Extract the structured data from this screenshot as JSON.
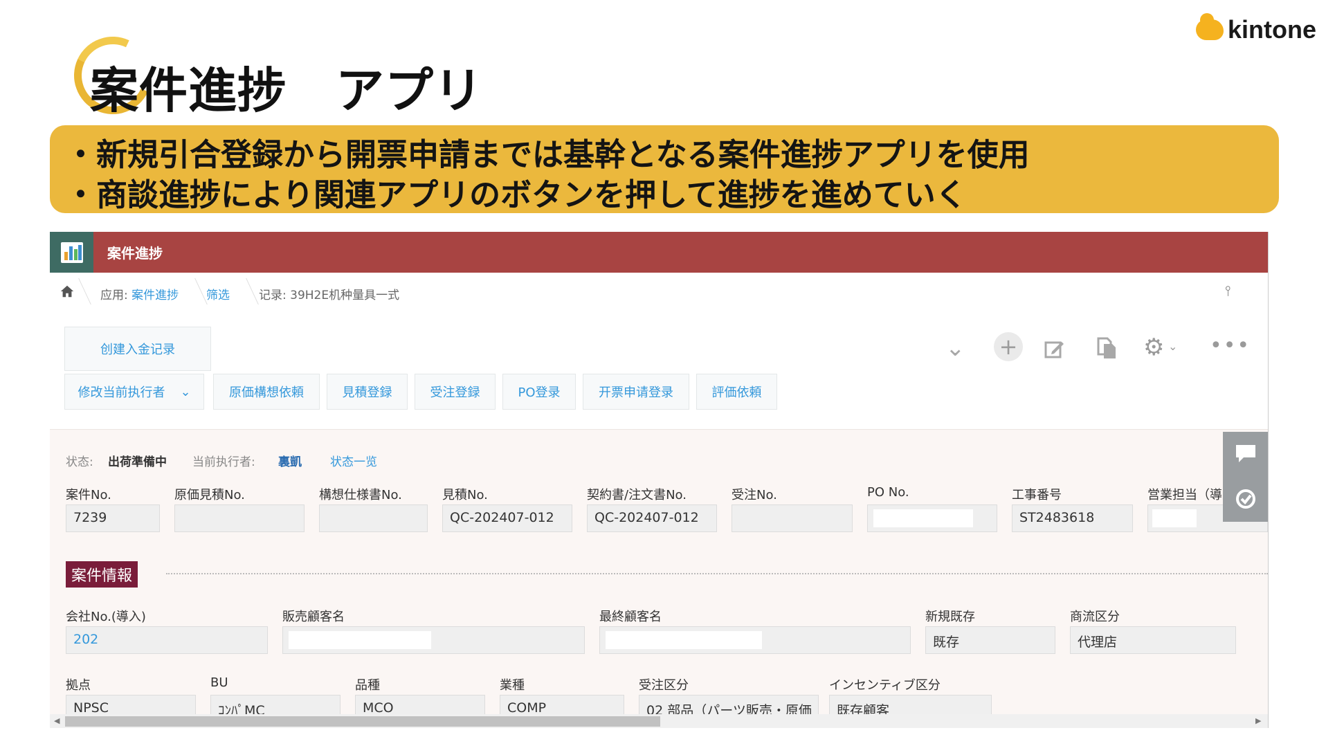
{
  "slide": {
    "title": "案件進捗　アプリ",
    "logo_text": "kintone",
    "bullets": [
      "・新規引合登録から開票申請までは基幹となる案件進捗アプリを使用",
      "・商談進捗により関連アプリのボタンを押して進捗を進めていく"
    ]
  },
  "app": {
    "name": "案件進捗",
    "breadcrumb": {
      "app_prefix": "应用: ",
      "app_link": "案件進捗",
      "filter": "筛选",
      "record": "记录: 39H2E机种量具一式"
    },
    "buttons": {
      "create": "创建入金记录",
      "change_assignee": "修改当前执行者",
      "actions": [
        "原価構想依頼",
        "見積登録",
        "受注登録",
        "PO登录",
        "开票申请登录",
        "評価依頼"
      ]
    },
    "status": {
      "label": "状态:",
      "value": "出荷準備中",
      "assignee_label": "当前执行者:",
      "assignee": "裏凱",
      "history": "状态一览"
    },
    "fields_row1": [
      {
        "label": "案件No.",
        "value": "7239"
      },
      {
        "label": "原価見積No.",
        "value": ""
      },
      {
        "label": "構想仕様書No.",
        "value": ""
      },
      {
        "label": "見積No.",
        "value": "QC-202407-012"
      },
      {
        "label": "契約書/注文書No.",
        "value": "QC-202407-012"
      },
      {
        "label": "受注No.",
        "value": ""
      },
      {
        "label": "PO No.",
        "value": ""
      },
      {
        "label": "工事番号",
        "value": "ST2483618"
      },
      {
        "label": "営業担当（導入",
        "value": ""
      }
    ],
    "section": "案件情報",
    "fields_row2": [
      {
        "label": "会社No.(導入)",
        "value": "202"
      },
      {
        "label": "販売顧客名",
        "value": ""
      },
      {
        "label": "最終顧客名",
        "value": ""
      },
      {
        "label": "新規既存",
        "value": "既存"
      },
      {
        "label": "商流区分",
        "value": "代理店"
      }
    ],
    "fields_row3": [
      {
        "label": "拠点",
        "value": "NPSC"
      },
      {
        "label": "BU",
        "value": "ｺﾝﾊﾟMC"
      },
      {
        "label": "品種",
        "value": "MCO"
      },
      {
        "label": "業種",
        "value": "COMP"
      },
      {
        "label": "受注区分",
        "value": "02 部品（パーツ販売・原価"
      },
      {
        "label": "インセンティブ区分",
        "value": "既存顧客"
      }
    ]
  }
}
